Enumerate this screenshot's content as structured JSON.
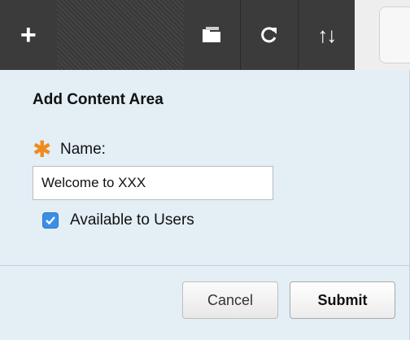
{
  "toolbar": {
    "add_label": "+",
    "icons": [
      "plus-icon",
      "folder-icon",
      "refresh-icon",
      "sort-arrows-icon"
    ],
    "sort_glyph": "↑↓"
  },
  "dialog": {
    "title": "Add Content Area",
    "required_marker": "✱",
    "name_label": "Name:",
    "name_value": "Welcome to XXX",
    "available_label": "Available to Users",
    "available_checked": true
  },
  "footer": {
    "cancel_label": "Cancel",
    "submit_label": "Submit"
  },
  "colors": {
    "toolbar_bg": "#3b3b3b",
    "panel_bg": "#e3eef5",
    "required_orange": "#f08a1c",
    "checkbox_blue": "#3a8ee6"
  }
}
